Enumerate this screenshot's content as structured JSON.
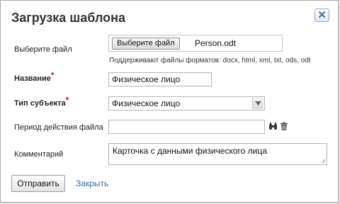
{
  "dialog": {
    "title": "Загрузка шаблона",
    "close_icon": "close-x-icon"
  },
  "form": {
    "file": {
      "label": "Выберите файл",
      "button_label": "Выберите файл",
      "file_name": "Person.odt",
      "hint": "Поддерживают файлы форматов: docx, html, xml, txt, ods, odt"
    },
    "name": {
      "label": "Название",
      "required_mark": "*",
      "value": "Физическое лицо"
    },
    "subject_type": {
      "label": "Тип субъекта",
      "required_mark": "*",
      "selected": "Физическое лицо"
    },
    "validity_period": {
      "label": "Период действия файла",
      "value": "",
      "calendar_icon": "binoculars-icon",
      "clear_icon": "trash-icon"
    },
    "comment": {
      "label": "Комментарий",
      "value": "Карточка с данными физического лица"
    }
  },
  "actions": {
    "submit_label": "Отправить",
    "close_label": "Закрыть"
  },
  "colors": {
    "required": "#cc0000",
    "link": "#2a6fb7",
    "close_button_border": "#8fa6bd"
  }
}
